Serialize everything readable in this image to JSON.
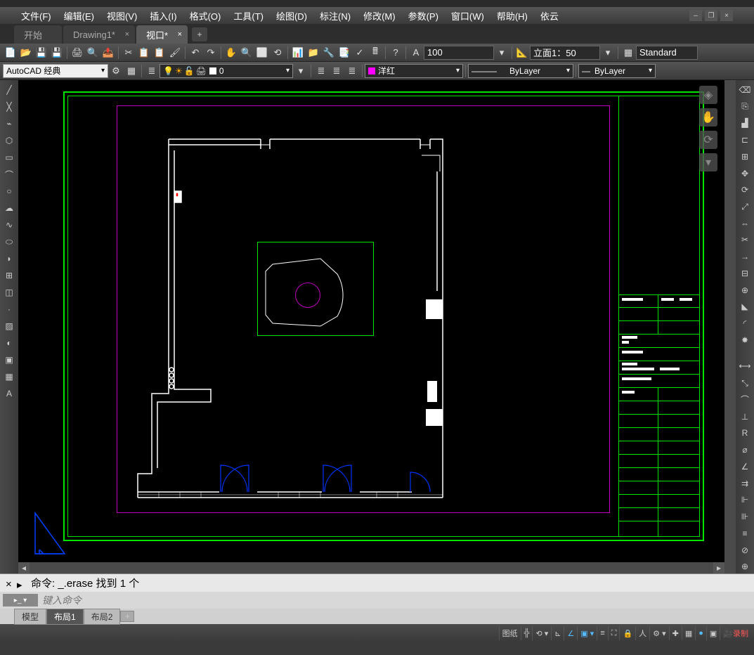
{
  "menus": {
    "file": "文件(F)",
    "edit": "编辑(E)",
    "view": "视图(V)",
    "insert": "插入(I)",
    "format": "格式(O)",
    "tools": "工具(T)",
    "draw": "绘图(D)",
    "dimension": "标注(N)",
    "modify": "修改(M)",
    "parametric": "参数(P)",
    "window": "窗口(W)",
    "help": "帮助(H)",
    "yiyun": "依云"
  },
  "tabs": {
    "start": "开始",
    "drawing1": "Drawing1*",
    "viewport": "视口*"
  },
  "workspace": "AutoCAD 经典",
  "layer_current": "0",
  "color_current": "洋红",
  "linetype": "ByLayer",
  "lineweight": "ByLayer",
  "textscale": "100",
  "viewscale": "立面1：50",
  "textstyle": "Standard",
  "command_history": "命令: _.erase 找到 1 个",
  "command_placeholder": "键入命令",
  "layout_tabs": {
    "model": "模型",
    "layout1": "布局1",
    "layout2": "布局2"
  },
  "status": {
    "paper": "图纸"
  }
}
